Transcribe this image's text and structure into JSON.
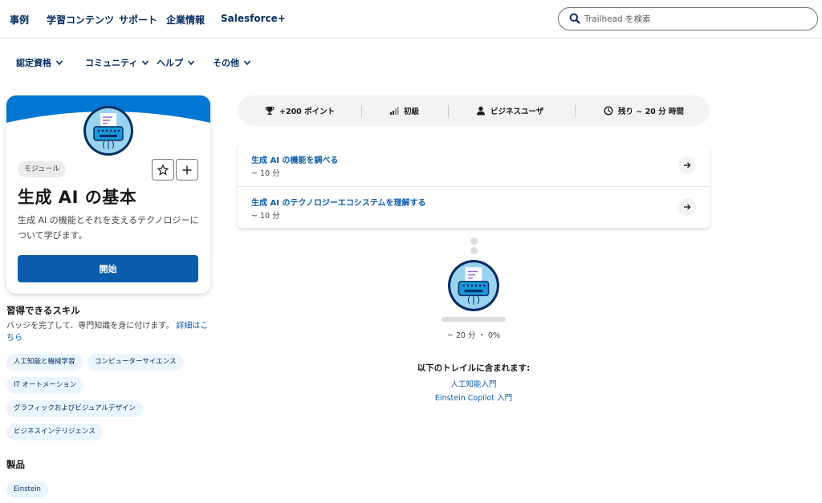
{
  "top_nav": {
    "links": [
      "事例",
      "学習コンテンツ",
      "サポート",
      "企業情報",
      "Salesforce+"
    ],
    "search_placeholder": "Trailhead を検索"
  },
  "sub_nav": {
    "items": [
      "認定資格",
      "コミュニティ",
      "ヘルプ",
      "その他"
    ]
  },
  "module_card": {
    "tag": "モジュール",
    "title": "生成 AI の基本",
    "description": "生成 AI の機能とそれを支えるテクノロジーについて学びます。",
    "start_label": "開始",
    "icons": [
      "star-icon",
      "plus-icon"
    ]
  },
  "skills": {
    "title": "習得できるスキル",
    "description": "バッジを完了して、専門知識を身に付けます。",
    "details_link": "詳細はこちら",
    "pills": [
      "人工知能と機械学習",
      "コンピューターサイエンス",
      "IT オートメーション",
      "グラフィックおよびビジュアルデザイン",
      "ビジネスインテリジェンス"
    ]
  },
  "products": {
    "title": "製品",
    "pills": [
      "Einstein"
    ]
  },
  "info_bar": {
    "points": "+200 ポイント",
    "level": "初級",
    "role": "ビジネスユーザ",
    "time": "残り ~ 20 分 時間"
  },
  "units": [
    {
      "title": "生成 AI の機能を調べる",
      "duration": "~ 10 分"
    },
    {
      "title": "生成 AI のテクノロジーエコシステムを理解する",
      "duration": "~ 10 分"
    }
  ],
  "progress": {
    "value": 0,
    "summary": "~ 20 分 ・ 0%"
  },
  "trails": {
    "title": "以下のトレイルに含まれます:",
    "items": [
      "人工知能入門",
      "Einstein Copilot 入門"
    ]
  },
  "colors": {
    "brand_blue": "#0b5cab",
    "banner_blue": "#0176d3",
    "navy": "#032d60",
    "pill_bg": "#eaf5fe"
  }
}
